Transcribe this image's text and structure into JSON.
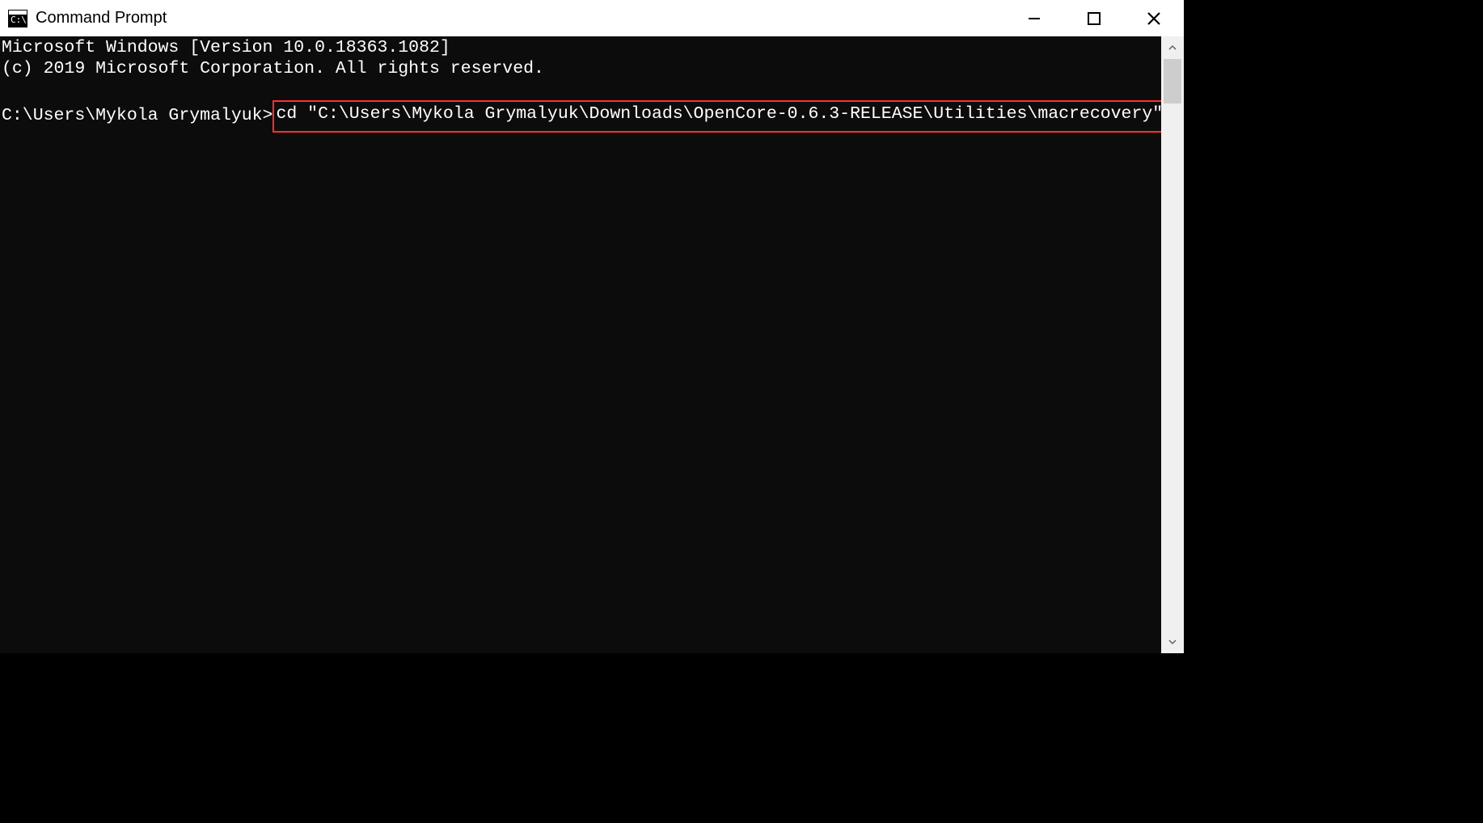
{
  "window": {
    "title": "Command Prompt"
  },
  "terminal": {
    "line1": "Microsoft Windows [Version 10.0.18363.1082]",
    "line2": "(c) 2019 Microsoft Corporation. All rights reserved.",
    "prompt": "C:\\Users\\Mykola Grymalyuk>",
    "command": "cd \"C:\\Users\\Mykola Grymalyuk\\Downloads\\OpenCore-0.6.3-RELEASE\\Utilities\\macrecovery\""
  },
  "annotation": {
    "highlight_color": "#ff3030"
  }
}
